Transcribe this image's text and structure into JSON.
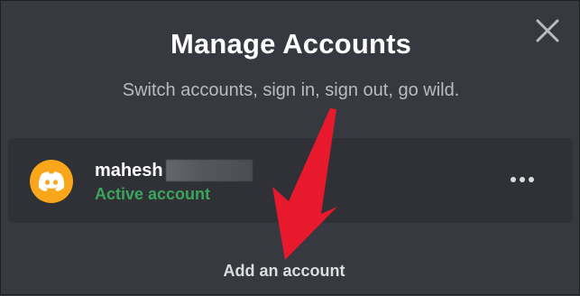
{
  "dialog": {
    "title": "Manage Accounts",
    "subtitle": "Switch accounts, sign in, sign out, go wild.",
    "close_icon": "close-icon"
  },
  "account": {
    "username": "mahesh",
    "status": "Active account",
    "avatar_icon": "discord-logo-icon",
    "more_icon": "more-options-icon"
  },
  "add_account_label": "Add an account",
  "colors": {
    "background": "#36393f",
    "card": "#2f3136",
    "avatar": "#faa61a",
    "active_status": "#3ba55d",
    "annotation_arrow": "#e8192c"
  }
}
